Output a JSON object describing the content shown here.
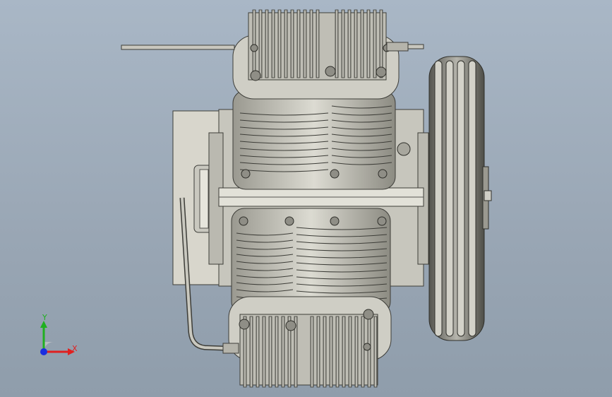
{
  "triad": {
    "x_label": "X",
    "y_label": "Y",
    "x_color": "#e02020",
    "y_color": "#20b020",
    "z_color": "#1a2ee0"
  },
  "colors": {
    "background_top": "#a9b7c6",
    "background_bottom": "#8f9dab",
    "metal": "#bdbcb4",
    "metal_dark": "#5f5f58",
    "plate": "#d8d6cc"
  },
  "parts": [
    "upper-cylinder-head",
    "lower-cylinder-head",
    "upper-cylinder-block",
    "lower-cylinder-block",
    "crankcase",
    "mounting-plate",
    "flywheel-pulley",
    "discharge-pipe",
    "intake-rod"
  ]
}
